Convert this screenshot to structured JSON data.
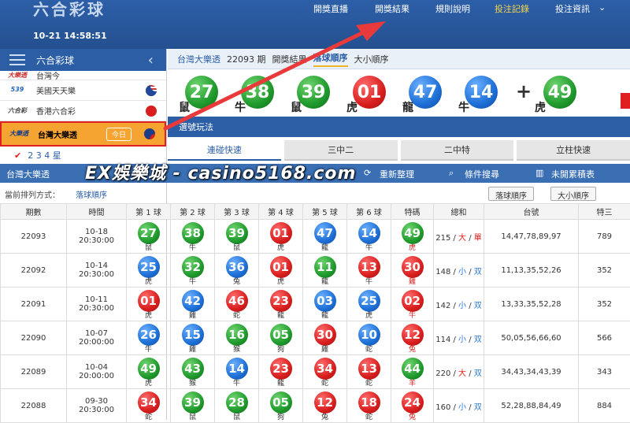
{
  "header": {
    "brand": "六合彩球",
    "clock": "10-21 14:58:51",
    "nav": [
      "開獎直播",
      "開獎結果",
      "規則說明",
      "投注記錄",
      "投注資訊"
    ]
  },
  "sidebar": {
    "title": "六合彩球",
    "items": [
      {
        "logo": "大樂透",
        "name": "台灣今"
      },
      {
        "logo": "539",
        "name": "美國天天樂"
      },
      {
        "logo": "六合彩",
        "name": "香港六合彩"
      },
      {
        "logo": "大樂透",
        "name": "台灣大樂透",
        "badge": "今日"
      }
    ],
    "sub": "2 3 4 星"
  },
  "breadcrumb": {
    "game": "台灣大樂透",
    "period": "22093 期",
    "section": "開獎結果",
    "tab_active": "落球順序",
    "tab_other": "大小順序"
  },
  "latest": {
    "balls": [
      {
        "n": "27",
        "z": "鼠",
        "c": "green"
      },
      {
        "n": "38",
        "z": "牛",
        "c": "green"
      },
      {
        "n": "39",
        "z": "鼠",
        "c": "green"
      },
      {
        "n": "01",
        "z": "虎",
        "c": "red"
      },
      {
        "n": "47",
        "z": "龍",
        "c": "blue"
      },
      {
        "n": "14",
        "z": "牛",
        "c": "blue"
      }
    ],
    "special": {
      "n": "49",
      "z": "虎",
      "c": "green"
    }
  },
  "select_title": "選號玩法",
  "tabs": [
    "連碰快速",
    "三中二",
    "二中特",
    "立柱快速"
  ],
  "toolbar": {
    "title": "台灣大樂透",
    "refresh": "重新整理",
    "search": "條件搜尋",
    "stats": "未開累積表"
  },
  "watermark": "EX娛樂城 - casino5168.com",
  "sort": {
    "label": "當前排列方式：",
    "value": "落球順序",
    "btn1": "落球順序",
    "btn2": "大小順序"
  },
  "table": {
    "headers": [
      "期數",
      "時間",
      "第 1 球",
      "第 2 球",
      "第 3 球",
      "第 4 球",
      "第 5 球",
      "第 6 球",
      "特碼",
      "總和",
      "台號",
      "特三"
    ],
    "rows": [
      {
        "p": "22093",
        "d": "10-18",
        "t": "20:30:00",
        "b": [
          [
            "27",
            "鼠",
            "green"
          ],
          [
            "38",
            "牛",
            "green"
          ],
          [
            "39",
            "鼠",
            "green"
          ],
          [
            "01",
            "虎",
            "red"
          ],
          [
            "47",
            "龍",
            "blue"
          ],
          [
            "14",
            "牛",
            "blue"
          ]
        ],
        "s": [
          "49",
          "虎",
          "green"
        ],
        "sum": "215",
        "bs": "大",
        "oe": "單",
        "tn": "14,47,78,89,97",
        "t3": "789"
      },
      {
        "p": "22092",
        "d": "10-14",
        "t": "20:30:00",
        "b": [
          [
            "25",
            "虎",
            "blue"
          ],
          [
            "32",
            "牛",
            "green"
          ],
          [
            "36",
            "兔",
            "blue"
          ],
          [
            "01",
            "虎",
            "red"
          ],
          [
            "11",
            "龍",
            "green"
          ],
          [
            "13",
            "牛",
            "red"
          ]
        ],
        "s": [
          "30",
          "雞",
          "red"
        ],
        "sum": "148",
        "bs": "小",
        "oe": "双",
        "tn": "11,13,35,52,26",
        "t3": "352"
      },
      {
        "p": "22091",
        "d": "10-11",
        "t": "20:30:00",
        "b": [
          [
            "01",
            "虎",
            "red"
          ],
          [
            "42",
            "雞",
            "blue"
          ],
          [
            "46",
            "蛇",
            "red"
          ],
          [
            "23",
            "龍",
            "red"
          ],
          [
            "03",
            "龍",
            "blue"
          ],
          [
            "25",
            "虎",
            "blue"
          ]
        ],
        "s": [
          "02",
          "牛",
          "red"
        ],
        "sum": "142",
        "bs": "小",
        "oe": "双",
        "tn": "13,33,35,52,28",
        "t3": "352"
      },
      {
        "p": "22090",
        "d": "10-07",
        "t": "20:00:00",
        "b": [
          [
            "26",
            "牛",
            "blue"
          ],
          [
            "15",
            "雞",
            "blue"
          ],
          [
            "16",
            "猴",
            "green"
          ],
          [
            "05",
            "狗",
            "green"
          ],
          [
            "30",
            "雞",
            "red"
          ],
          [
            "10",
            "蛇",
            "blue"
          ]
        ],
        "s": [
          "12",
          "兔",
          "red"
        ],
        "sum": "114",
        "bs": "小",
        "oe": "双",
        "tn": "50,05,56,66,60",
        "t3": "566"
      },
      {
        "p": "22089",
        "d": "10-04",
        "t": "20:00:00",
        "b": [
          [
            "49",
            "虎",
            "green"
          ],
          [
            "43",
            "猴",
            "green"
          ],
          [
            "14",
            "牛",
            "blue"
          ],
          [
            "23",
            "龍",
            "red"
          ],
          [
            "34",
            "蛇",
            "red"
          ],
          [
            "13",
            "蛇",
            "red"
          ]
        ],
        "s": [
          "44",
          "羊",
          "green"
        ],
        "sum": "220",
        "bs": "大",
        "oe": "双",
        "tn": "34,43,34,43,39",
        "t3": "343"
      },
      {
        "p": "22088",
        "d": "09-30",
        "t": "20:30:00",
        "b": [
          [
            "34",
            "蛇",
            "red"
          ],
          [
            "39",
            "鼠",
            "green"
          ],
          [
            "28",
            "鼠",
            "green"
          ],
          [
            "05",
            "狗",
            "green"
          ],
          [
            "12",
            "兔",
            "red"
          ],
          [
            "18",
            "蛇",
            "red"
          ]
        ],
        "s": [
          "24",
          "兔",
          "red"
        ],
        "sum": "160",
        "bs": "小",
        "oe": "双",
        "tn": "52,28,88,84,49",
        "t3": "884"
      }
    ]
  },
  "colors": {
    "red": "#d81e1e",
    "blue": "#1d6fd6",
    "green": "#1f9a2c",
    "header": "#2c5ea6",
    "active": "#f6a431"
  }
}
